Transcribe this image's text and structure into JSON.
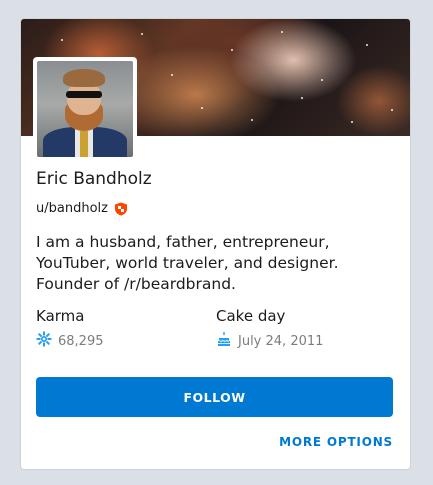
{
  "profile": {
    "name": "Eric Bandholz",
    "username": "u/bandholz",
    "bio": "I am a husband, father, entrepreneur, YouTuber, world traveler, and designer. Founder of /r/beardbrand."
  },
  "stats": {
    "karma_label": "Karma",
    "karma_value": "68,295",
    "karma_icon": "karma-icon",
    "cakeday_label": "Cake day",
    "cakeday_value": "July 24, 2011",
    "cakeday_icon": "cake-icon"
  },
  "actions": {
    "follow_label": "FOLLOW",
    "more_options_label": "MORE OPTIONS"
  },
  "colors": {
    "accent": "#0079d3",
    "mod_badge": "#ff4500",
    "background": "#dae0e6"
  }
}
